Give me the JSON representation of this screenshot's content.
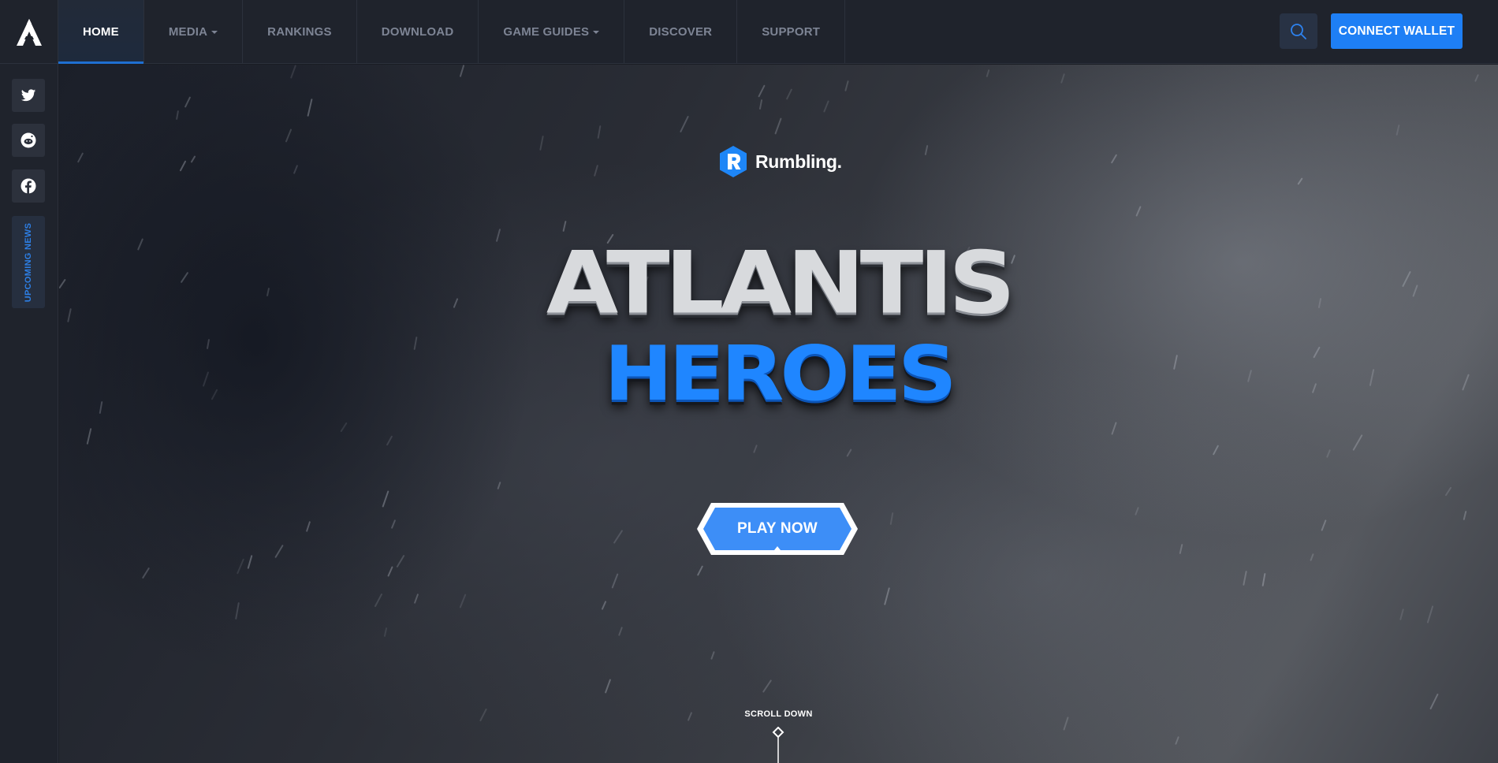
{
  "topbar": {
    "nav": [
      {
        "label": "HOME",
        "active": true,
        "dropdown": false
      },
      {
        "label": "MEDIA",
        "active": false,
        "dropdown": true
      },
      {
        "label": "RANKINGS",
        "active": false,
        "dropdown": false
      },
      {
        "label": "DOWNLOAD",
        "active": false,
        "dropdown": false
      },
      {
        "label": "GAME GUIDES",
        "active": false,
        "dropdown": true
      },
      {
        "label": "DISCOVER",
        "active": false,
        "dropdown": false
      },
      {
        "label": "SUPPORT",
        "active": false,
        "dropdown": false
      }
    ],
    "search_icon": "search-icon",
    "connect_label": "CONNECT WALLET"
  },
  "sidebar": {
    "socials": [
      "twitter-icon",
      "reddit-icon",
      "facebook-icon"
    ],
    "news_label": "UPCOMING NEWS"
  },
  "hero": {
    "brand": "Rumbling.",
    "title_line1": "ATLANTIS",
    "title_line2": "HEROES",
    "cta_label": "PLAY NOW",
    "scroll_label": "SCROLL DOWN"
  },
  "colors": {
    "accent": "#1e7ff5",
    "nav_bg": "#1f232c",
    "title_blue": "#1f86ff"
  }
}
